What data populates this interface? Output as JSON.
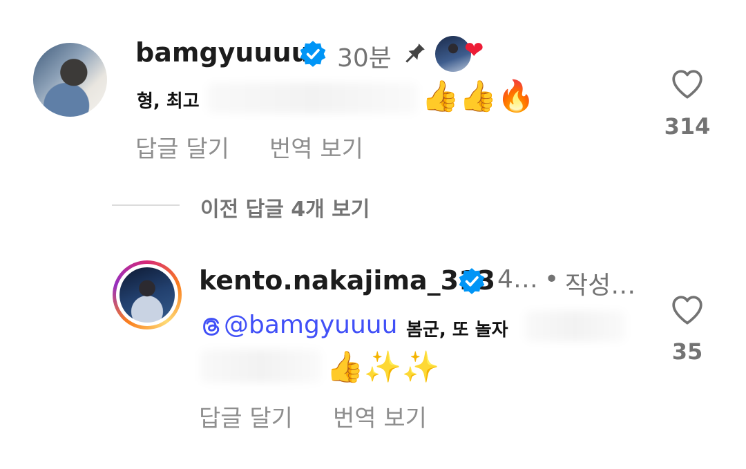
{
  "comment1": {
    "username": "bamgyuuuu",
    "time": "30분",
    "text": "형, 최고",
    "emoji": "👍👍🔥",
    "likes": "314",
    "reply_label": "답글 달기",
    "translate_label": "번역 보기",
    "liked_by_author_heart": "❤"
  },
  "thread": {
    "view_previous_label": "이전 답글 4개 보기"
  },
  "comment2": {
    "username": "kento.nakajima_313",
    "time": "4…",
    "separator": "•",
    "author_label": "작성…",
    "mention": "@bamgyuuuu",
    "text": "봄군, 또 놀자",
    "emoji": "👍✨✨",
    "likes": "35",
    "reply_label": "답글 달기",
    "translate_label": "번역 보기"
  },
  "icons": {
    "verified": "verified-badge-icon",
    "pin": "pin-icon",
    "heart": "heart-outline-icon",
    "threads": "threads-logo-icon"
  },
  "colors": {
    "verified": "#0095f6",
    "mention": "#4150f7",
    "heart_red": "#ed1c36"
  }
}
